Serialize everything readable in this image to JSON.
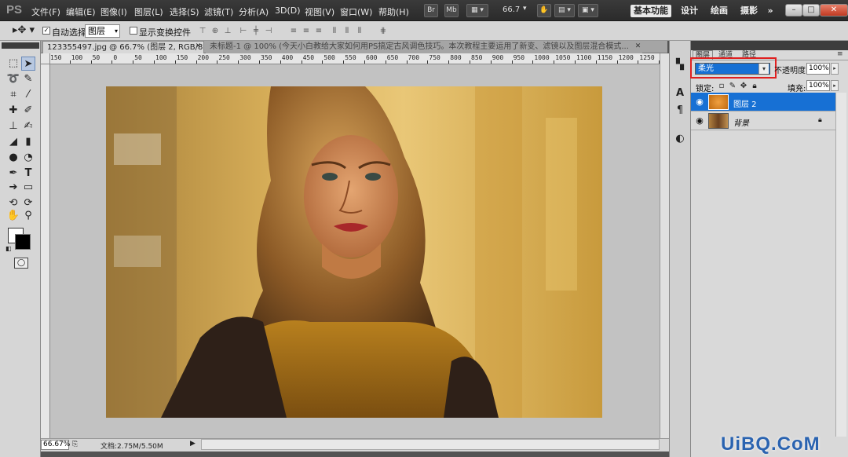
{
  "app": {
    "logo": "PS"
  },
  "menu": [
    "文件(F)",
    "编辑(E)",
    "图像(I)",
    "图层(L)",
    "选择(S)",
    "滤镜(T)",
    "分析(A)",
    "3D(D)",
    "视图(V)",
    "窗口(W)",
    "帮助(H)"
  ],
  "appbar": {
    "br_label": "Br",
    "mb_label": "Mb",
    "zoom": "66.7"
  },
  "workspaces": [
    "基本功能",
    "设计",
    "绘画",
    "摄影",
    "»"
  ],
  "window_controls": {
    "minimize": "–",
    "restore": "□",
    "close": "✕"
  },
  "options": {
    "auto_select_label": "自动选择:",
    "auto_select_checked": true,
    "auto_select_target": "图层",
    "show_transform_label": "显示变换控件"
  },
  "tabs": [
    {
      "title": "123355497.jpg @ 66.7% (图层 2, RGB/8) *",
      "active": true
    },
    {
      "title": "未标题-1 @ 100% (今天小白教给大家如何用PS搞定古风调色技巧。本次教程主要运用了新变、滤镜以及图层混合模式...",
      "active": false
    }
  ],
  "ruler": {
    "marks": [
      "150",
      "100",
      "50",
      "0",
      "50",
      "100",
      "150",
      "200",
      "250",
      "300",
      "350",
      "400",
      "450",
      "500",
      "550",
      "600",
      "650",
      "700",
      "750",
      "800",
      "850",
      "900",
      "950",
      "1000",
      "1050",
      "1100",
      "1150",
      "1200",
      "1250",
      "1300"
    ]
  },
  "status": {
    "zoom": "66.67%",
    "doc_info": "文档:2.75M/5.50M"
  },
  "layers_panel": {
    "tabs": [
      "图层",
      "通道",
      "路径"
    ],
    "blend_mode": "柔光",
    "opacity_label": "不透明度:",
    "opacity": "100%",
    "lock_label": "锁定:",
    "fill_label": "填充:",
    "fill": "100%",
    "layers": [
      {
        "name": "图层 2",
        "selected": true,
        "visible": true
      },
      {
        "name": "背景",
        "selected": false,
        "visible": true,
        "locked": true
      }
    ]
  },
  "watermark": "UiBQ.CoM",
  "colors": {
    "selection_blue": "#1770d4",
    "highlight_red": "#e02020",
    "canvas_gray": "#c2c2c2"
  }
}
